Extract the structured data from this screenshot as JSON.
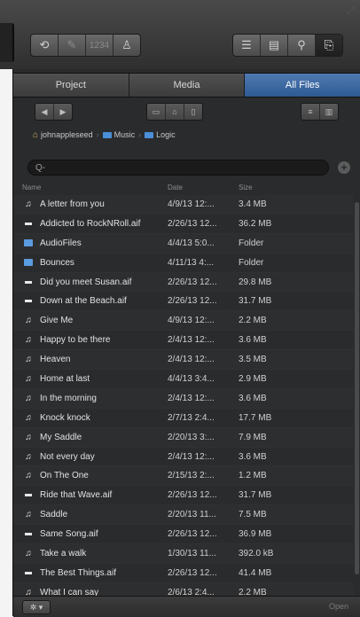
{
  "toolbar": {
    "buttons_left": [
      {
        "name": "cycle-icon",
        "glyph": "⟲"
      },
      {
        "name": "pencil-icon",
        "glyph": "✎"
      },
      {
        "name": "count-in-label",
        "text": "1234"
      },
      {
        "name": "metronome-icon",
        "glyph": "♙"
      }
    ],
    "buttons_right": [
      {
        "name": "list-editors-icon",
        "glyph": "☰"
      },
      {
        "name": "notepad-icon",
        "glyph": "▤"
      },
      {
        "name": "loop-browser-icon",
        "glyph": "⚲"
      },
      {
        "name": "browser-icon",
        "glyph": "⎘"
      }
    ]
  },
  "tabs": [
    {
      "label": "Project",
      "active": false
    },
    {
      "label": "Media",
      "active": false
    },
    {
      "label": "All Files",
      "active": true
    }
  ],
  "breadcrumb": {
    "items": [
      "johnappleseed",
      "Music",
      "Logic"
    ]
  },
  "search": {
    "placeholder": "Q-"
  },
  "columns": {
    "name": "Name",
    "date": "Date",
    "size": "Size"
  },
  "files": [
    {
      "icon": "note",
      "name": "A letter from you",
      "date": "4/9/13 12:...",
      "size": "3.4 MB"
    },
    {
      "icon": "wave",
      "name": "Addicted to RockNRoll.aif",
      "date": "2/26/13 12...",
      "size": "36.2 MB"
    },
    {
      "icon": "folder",
      "name": "AudioFiles",
      "date": "4/4/13 5:0...",
      "size": "Folder"
    },
    {
      "icon": "folder",
      "name": "Bounces",
      "date": "4/11/13 4:...",
      "size": "Folder"
    },
    {
      "icon": "wave",
      "name": "Did you meet Susan.aif",
      "date": "2/26/13 12...",
      "size": "29.8 MB"
    },
    {
      "icon": "wave",
      "name": "Down at the Beach.aif",
      "date": "2/26/13 12...",
      "size": "31.7 MB"
    },
    {
      "icon": "note",
      "name": "Give Me",
      "date": "4/9/13 12:...",
      "size": "2.2 MB"
    },
    {
      "icon": "note",
      "name": "Happy to be there",
      "date": "2/4/13 12:...",
      "size": "3.6 MB"
    },
    {
      "icon": "note",
      "name": "Heaven",
      "date": "2/4/13 12:...",
      "size": "3.5 MB"
    },
    {
      "icon": "note",
      "name": "Home at last",
      "date": "4/4/13 3:4...",
      "size": "2.9 MB"
    },
    {
      "icon": "note",
      "name": "In the morning",
      "date": "2/4/13 12:...",
      "size": "3.6 MB"
    },
    {
      "icon": "note",
      "name": "Knock knock",
      "date": "2/7/13 2:4...",
      "size": "17.7 MB"
    },
    {
      "icon": "note",
      "name": "My Saddle",
      "date": "2/20/13 3:...",
      "size": "7.9 MB"
    },
    {
      "icon": "note",
      "name": "Not every day",
      "date": "2/4/13 12:...",
      "size": "3.6 MB"
    },
    {
      "icon": "note",
      "name": "On The One",
      "date": "2/15/13 2:...",
      "size": "1.2 MB"
    },
    {
      "icon": "wave",
      "name": "Ride that Wave.aif",
      "date": "2/26/13 12...",
      "size": "31.7 MB"
    },
    {
      "icon": "note",
      "name": "Saddle",
      "date": "2/20/13 11...",
      "size": "7.5 MB"
    },
    {
      "icon": "wave",
      "name": "Same Song.aif",
      "date": "2/26/13 12...",
      "size": "36.9 MB"
    },
    {
      "icon": "note",
      "name": "Take a walk",
      "date": "1/30/13 11...",
      "size": "392.0 kB"
    },
    {
      "icon": "wave",
      "name": "The Best Things.aif",
      "date": "2/26/13 12...",
      "size": "41.4 MB"
    },
    {
      "icon": "note",
      "name": "What I can say",
      "date": "2/6/13 2:4...",
      "size": "2.2 MB"
    }
  ],
  "bottom": {
    "action_glyph": "✲ ▾",
    "open_label": "Open"
  },
  "colors": {
    "panel_bg": "#2a2b2d",
    "active_tab": "#3a68a4",
    "folder": "#5b9be0"
  }
}
